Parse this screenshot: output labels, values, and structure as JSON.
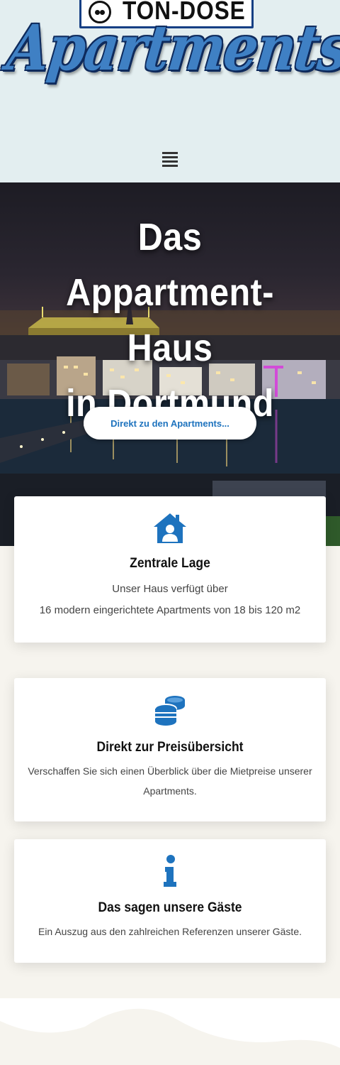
{
  "logo": {
    "top_text": "TON-DOSE",
    "script_text": "Apartments"
  },
  "header": {
    "menu_icon": "hamburger-menu-icon",
    "background": "#e3eef0"
  },
  "hero": {
    "title_line1": "Das Appartment-",
    "title_line2": "Haus",
    "title_line3": "in Dortmund",
    "button_label": "Direkt zu den Apartments..."
  },
  "cards": [
    {
      "icon": "house-user-icon",
      "title": "Zentrale Lage",
      "text_line1": "Unser Haus verfügt über",
      "text_line2": "16 modern eingerichtete Apartments von 18 bis 120 m2"
    },
    {
      "icon": "coins-icon",
      "title": "Direkt zur Preisübersicht",
      "text_line1": "Verschaffen Sie sich einen Überblick über die Mietpreise unserer",
      "text_line2": "Apartments."
    },
    {
      "icon": "info-icon",
      "title": "Das sagen unsere Gäste",
      "text_line1": "Ein Auszug aus den zahlreichen Referenzen unserer Gäste."
    }
  ],
  "colors": {
    "accent": "#1e73be",
    "page_background": "#f6f4ee",
    "card_background": "#ffffff"
  }
}
